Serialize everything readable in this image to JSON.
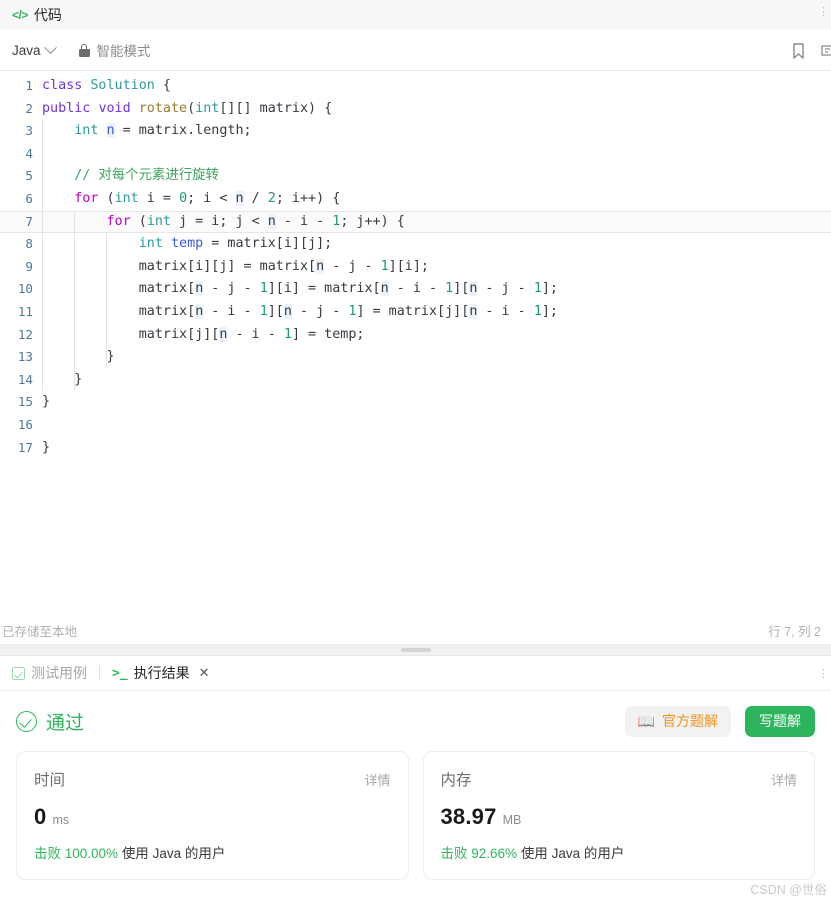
{
  "panel": {
    "title": "代码",
    "code_icon": "code-brackets-icon",
    "overflow_menu": "⋮"
  },
  "toolbar": {
    "language": "Java",
    "chevron_icon": "chevron-down-icon",
    "lock_icon": "lock-icon",
    "mode_label": "智能模式",
    "bookmark_icon": "bookmark-icon",
    "settings_icon": "settings-icon"
  },
  "editor": {
    "active_line": 7,
    "lines": [
      {
        "no": "1",
        "indents": 0,
        "tokens": [
          {
            "t": "class ",
            "c": "t-kw"
          },
          {
            "t": "Solution",
            "c": "t-type"
          },
          {
            "t": " {",
            "c": "t-def"
          }
        ]
      },
      {
        "no": "2",
        "indents": 0,
        "tokens": [
          {
            "t": "public",
            "c": "t-kw"
          },
          {
            "t": " ",
            "c": "t-def"
          },
          {
            "t": "void",
            "c": "t-kw"
          },
          {
            "t": " ",
            "c": "t-def"
          },
          {
            "t": "rotate",
            "c": "t-fn"
          },
          {
            "t": "(",
            "c": "t-def"
          },
          {
            "t": "int",
            "c": "t-int"
          },
          {
            "t": "[][] matrix) {",
            "c": "t-def"
          }
        ]
      },
      {
        "no": "3",
        "indents": 1,
        "tokens": [
          {
            "t": "    ",
            "c": "t-def"
          },
          {
            "t": "int",
            "c": "t-int"
          },
          {
            "t": " ",
            "c": "t-def"
          },
          {
            "t": "n",
            "c": "t-var hl"
          },
          {
            "t": " = matrix.length;",
            "c": "t-def"
          }
        ]
      },
      {
        "no": "4",
        "indents": 1,
        "tokens": [
          {
            "t": "",
            "c": "t-def"
          }
        ]
      },
      {
        "no": "5",
        "indents": 1,
        "tokens": [
          {
            "t": "    // 对每个元素进行旋转",
            "c": "t-cmt"
          }
        ]
      },
      {
        "no": "6",
        "indents": 1,
        "tokens": [
          {
            "t": "    ",
            "c": "t-def"
          },
          {
            "t": "for",
            "c": "t-kw2"
          },
          {
            "t": " (",
            "c": "t-def"
          },
          {
            "t": "int",
            "c": "t-int"
          },
          {
            "t": " i = ",
            "c": "t-def"
          },
          {
            "t": "0",
            "c": "t-num"
          },
          {
            "t": "; i < ",
            "c": "t-def"
          },
          {
            "t": "n",
            "c": "t-def hl"
          },
          {
            "t": " / ",
            "c": "t-def"
          },
          {
            "t": "2",
            "c": "t-num"
          },
          {
            "t": "; i++) {",
            "c": "t-def"
          }
        ]
      },
      {
        "no": "7",
        "indents": 2,
        "tokens": [
          {
            "t": "        ",
            "c": "t-def"
          },
          {
            "t": "for",
            "c": "t-kw2"
          },
          {
            "t": " (",
            "c": "t-def"
          },
          {
            "t": "int",
            "c": "t-int"
          },
          {
            "t": " j = i; j < ",
            "c": "t-def"
          },
          {
            "t": "n",
            "c": "t-def hl"
          },
          {
            "t": " - i - ",
            "c": "t-def"
          },
          {
            "t": "1",
            "c": "t-num"
          },
          {
            "t": "; j++) {",
            "c": "t-def"
          }
        ]
      },
      {
        "no": "8",
        "indents": 3,
        "tokens": [
          {
            "t": "            ",
            "c": "t-def"
          },
          {
            "t": "int",
            "c": "t-int"
          },
          {
            "t": " ",
            "c": "t-def"
          },
          {
            "t": "temp",
            "c": "t-var"
          },
          {
            "t": " = matrix[i][j];",
            "c": "t-def"
          }
        ]
      },
      {
        "no": "9",
        "indents": 3,
        "tokens": [
          {
            "t": "            matrix[i][j] = matrix[",
            "c": "t-def"
          },
          {
            "t": "n",
            "c": "t-def hl"
          },
          {
            "t": " - j - ",
            "c": "t-def"
          },
          {
            "t": "1",
            "c": "t-num"
          },
          {
            "t": "][i];",
            "c": "t-def"
          }
        ]
      },
      {
        "no": "10",
        "indents": 3,
        "tokens": [
          {
            "t": "            matrix[",
            "c": "t-def"
          },
          {
            "t": "n",
            "c": "t-def hl"
          },
          {
            "t": " - j - ",
            "c": "t-def"
          },
          {
            "t": "1",
            "c": "t-num"
          },
          {
            "t": "][i] = matrix[",
            "c": "t-def"
          },
          {
            "t": "n",
            "c": "t-def hl"
          },
          {
            "t": " - i - ",
            "c": "t-def"
          },
          {
            "t": "1",
            "c": "t-num"
          },
          {
            "t": "][",
            "c": "t-def"
          },
          {
            "t": "n",
            "c": "t-def hl"
          },
          {
            "t": " - j - ",
            "c": "t-def"
          },
          {
            "t": "1",
            "c": "t-num"
          },
          {
            "t": "];",
            "c": "t-def"
          }
        ]
      },
      {
        "no": "11",
        "indents": 3,
        "tokens": [
          {
            "t": "            matrix[",
            "c": "t-def"
          },
          {
            "t": "n",
            "c": "t-def hl"
          },
          {
            "t": " - i - ",
            "c": "t-def"
          },
          {
            "t": "1",
            "c": "t-num"
          },
          {
            "t": "][",
            "c": "t-def"
          },
          {
            "t": "n",
            "c": "t-def hl"
          },
          {
            "t": " - j - ",
            "c": "t-def"
          },
          {
            "t": "1",
            "c": "t-num"
          },
          {
            "t": "] = matrix[j][",
            "c": "t-def"
          },
          {
            "t": "n",
            "c": "t-def hl"
          },
          {
            "t": " - i - ",
            "c": "t-def"
          },
          {
            "t": "1",
            "c": "t-num"
          },
          {
            "t": "];",
            "c": "t-def"
          }
        ]
      },
      {
        "no": "12",
        "indents": 3,
        "tokens": [
          {
            "t": "            matrix[j][",
            "c": "t-def"
          },
          {
            "t": "n",
            "c": "t-def hl"
          },
          {
            "t": " - i - ",
            "c": "t-def"
          },
          {
            "t": "1",
            "c": "t-num"
          },
          {
            "t": "] = temp;",
            "c": "t-def"
          }
        ]
      },
      {
        "no": "13",
        "indents": 3,
        "tokens": [
          {
            "t": "        }",
            "c": "t-def"
          }
        ]
      },
      {
        "no": "14",
        "indents": 2,
        "tokens": [
          {
            "t": "    }",
            "c": "t-def"
          }
        ]
      },
      {
        "no": "15",
        "indents": 0,
        "tokens": [
          {
            "t": "}",
            "c": "t-def"
          }
        ]
      },
      {
        "no": "16",
        "indents": 0,
        "tokens": [
          {
            "t": "",
            "c": "t-def"
          }
        ]
      },
      {
        "no": "17",
        "indents": 0,
        "tokens": [
          {
            "t": "}",
            "c": "t-def"
          }
        ]
      }
    ]
  },
  "status": {
    "saved_text": "已存储至本地",
    "cursor_text": "行 7, 列 2"
  },
  "splitter": {
    "handle": "drag-handle"
  },
  "result": {
    "tabs": [
      {
        "label": "测试用例",
        "icon": "check-square-icon",
        "active": false
      },
      {
        "label": "执行结果",
        "icon": "terminal-icon",
        "active": true
      }
    ],
    "close_label": "✕",
    "overflow_menu": "⋮",
    "verdict": "通过",
    "verdict_icon": "check-circle-icon",
    "solution_button": "官方题解",
    "solution_icon": "book-icon",
    "write_button": "写题解",
    "cards": [
      {
        "label": "时间",
        "detail": "详情",
        "value": "0",
        "unit": "ms",
        "beat": "击败 100.00%",
        "beat_suffix": "使用 Java 的用户"
      },
      {
        "label": "内存",
        "detail": "详情",
        "value": "38.97",
        "unit": "MB",
        "beat": "击败 92.66%",
        "beat_suffix": "使用 Java 的用户"
      }
    ]
  },
  "watermark": "CSDN @世俗"
}
